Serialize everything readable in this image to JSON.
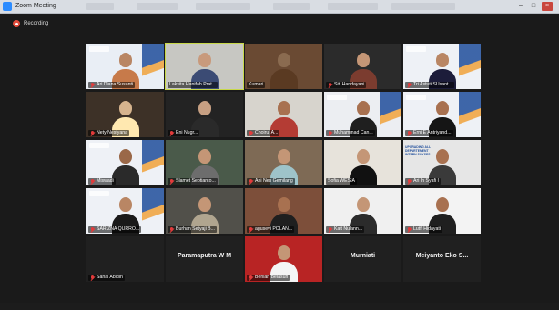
{
  "window": {
    "title": "Zoom Meeting"
  },
  "recording": {
    "label": "Recording"
  },
  "participants": [
    {
      "name": "Ari Diana Susanti",
      "display": "video",
      "muted": true,
      "bg": "#e9eef5",
      "skin": "#b98664",
      "top": "#c77a4a"
    },
    {
      "name": "Laksita Hanifah Prat...",
      "display": "video",
      "muted": false,
      "bg": "#c7c7c2",
      "skin": "#c89a7c",
      "top": "#3b4b74",
      "active": true
    },
    {
      "name": "Kumari",
      "display": "video",
      "muted": false,
      "bg": "#6a4a33",
      "skin": "#8a6b50",
      "top": "#5a3a22"
    },
    {
      "name": "Siti Handayani",
      "display": "video",
      "muted": true,
      "bg": "#2b2b2b",
      "skin": "#c49676",
      "top": "#7b3c2f"
    },
    {
      "name": "Tri Astuti SUsant...",
      "display": "video",
      "muted": true,
      "bg": "#eef1f6",
      "skin": "#b98664",
      "top": "#1c1c3a"
    },
    {
      "name": "Nety Nestyana",
      "display": "video",
      "muted": true,
      "bg": "#3d3127",
      "skin": "#d7b48e",
      "top": "#ffe8b0"
    },
    {
      "name": "Eni Nugr...",
      "display": "video",
      "muted": true,
      "bg": "#232323",
      "skin": "#c7a083",
      "top": "#2a2a2a"
    },
    {
      "name": "Choirul A...",
      "display": "video",
      "muted": true,
      "bg": "#d7d4cd",
      "skin": "#a87150",
      "top": "#b43c34"
    },
    {
      "name": "Muhammad Can...",
      "display": "video",
      "muted": true,
      "bg": "#eceef2",
      "skin": "#a87150",
      "top": "#1f1f1f"
    },
    {
      "name": "Erni E Antriyand...",
      "display": "video",
      "muted": true,
      "bg": "#eef1f6",
      "skin": "#a87150",
      "top": "#151515"
    },
    {
      "name": "Miswadi",
      "display": "video",
      "muted": true,
      "bg": "#eef1f6",
      "skin": "#9a6848",
      "top": "#2a2a2a"
    },
    {
      "name": "Slamet Septianto...",
      "display": "video",
      "muted": true,
      "bg": "#4a5a4a",
      "skin": "#c49676",
      "top": "#6d6d6d"
    },
    {
      "name": "Ani Nes Gemilang",
      "display": "video",
      "muted": true,
      "bg": "#7e6a55",
      "skin": "#c49676",
      "top": "#9ec3c9"
    },
    {
      "name": "Sofia WESIA",
      "display": "video",
      "muted": false,
      "bg": "#e7e3db",
      "skin": "#c49676",
      "top": "#111111"
    },
    {
      "name": "Ari In Syafi I",
      "display": "video",
      "muted": true,
      "bg": "#e6e6e6",
      "skin": "#a87150",
      "top": "#3a3a3a",
      "banner": "UPGRADING ALL DEPARTEMENT INTERN SUKSES"
    },
    {
      "name": "SARIZNA QURRO...",
      "display": "video",
      "muted": true,
      "bg": "#eef1f6",
      "skin": "#b98664",
      "top": "#1a1a1a"
    },
    {
      "name": "Burhan Setyaji B...",
      "display": "video",
      "muted": true,
      "bg": "#51504a",
      "skin": "#c49676",
      "top": "#b0a58f"
    },
    {
      "name": "agusevi POLAN...",
      "display": "video",
      "muted": true,
      "bg": "#7d4f3a",
      "skin": "#a87150",
      "top": "#1f1f1f"
    },
    {
      "name": "Kait Nulann...",
      "display": "video",
      "muted": true,
      "bg": "#f0f0f0",
      "skin": "#c49676",
      "top": "#2b2b2b"
    },
    {
      "name": "Lutfi Hidayati",
      "display": "video",
      "muted": true,
      "bg": "#f3f3f3",
      "skin": "#a87150",
      "top": "#1f1f1f"
    },
    {
      "name": "Sahal Abidin",
      "display": "blank",
      "muted": true
    },
    {
      "name": "Paramaputra W M",
      "display": "name-only",
      "muted": false
    },
    {
      "name": "Berlian Belasuri",
      "display": "video",
      "muted": true,
      "bg": "#b82424",
      "skin": "#c49676",
      "top": "#f4f4f4"
    },
    {
      "name": "Murniati",
      "display": "name-only",
      "muted": true
    },
    {
      "name": "Meiyanto Eko S...",
      "display": "name-only",
      "muted": true
    }
  ]
}
